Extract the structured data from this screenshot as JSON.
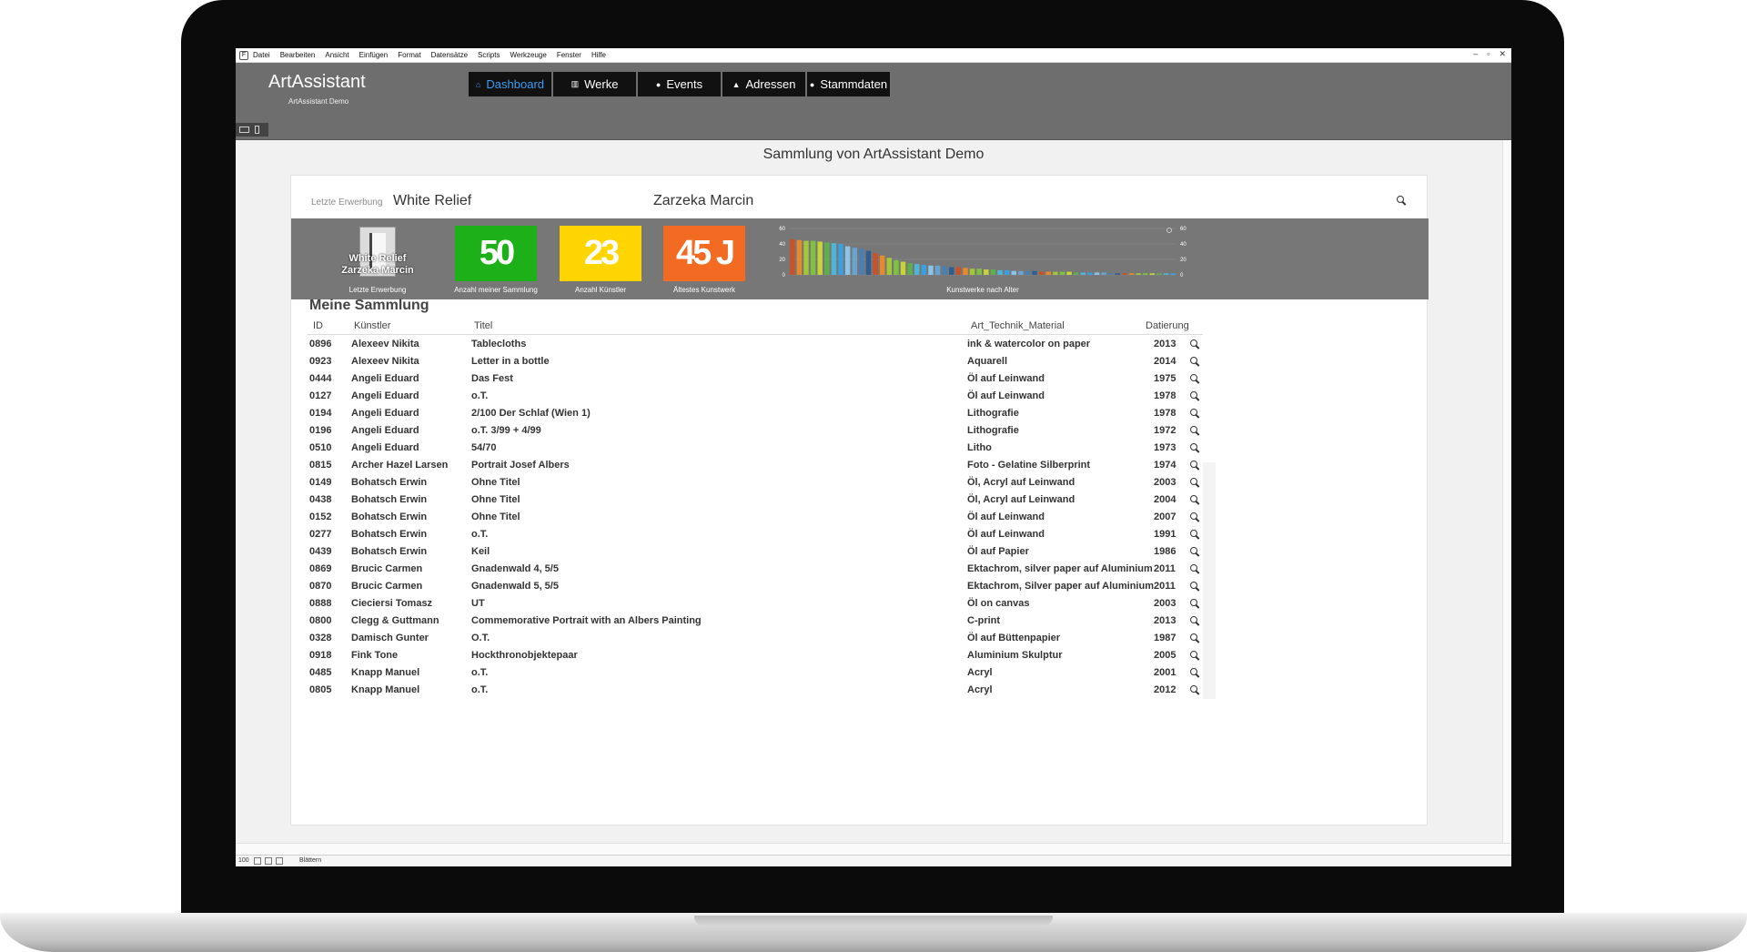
{
  "menu": [
    "Datei",
    "Bearbeiten",
    "Ansicht",
    "Einfügen",
    "Format",
    "Datensätze",
    "Scripts",
    "Werkzeuge",
    "Fenster",
    "Hilfe"
  ],
  "app": {
    "title": "ArtAssistant",
    "subtitle": "ArtAssistant Demo"
  },
  "nav": [
    {
      "label": "Dashboard",
      "icon": "home-icon",
      "active": true
    },
    {
      "label": "Werke",
      "icon": "grid-icon",
      "active": false
    },
    {
      "label": "Events",
      "icon": "globe-icon",
      "active": false
    },
    {
      "label": "Adressen",
      "icon": "person-icon",
      "active": false
    },
    {
      "label": "Stammdaten",
      "icon": "info-icon",
      "active": false
    }
  ],
  "collection_title": "Sammlung von ArtAssistant Demo",
  "latest": {
    "label": "Letzte Erwerbung",
    "title": "White Relief",
    "artist": "Zarzeka Marcin",
    "caption1": "White Relief",
    "caption2": "Zarzeka Marcin",
    "caption_label": "Letzte Erwerbung"
  },
  "kpis": [
    {
      "value": "50",
      "label": "Anzahl meiner Sammlung",
      "color": "#1eb018"
    },
    {
      "value": "23",
      "label": "Anzahl Künstler",
      "color": "#ffd500"
    },
    {
      "value": "45 J",
      "label": "Ältestes Kunstwerk",
      "color": "#f36a23"
    }
  ],
  "chart_data": {
    "type": "bar",
    "title": "",
    "xlabel": "Kunstwerke nach Alter",
    "ylabel": "",
    "ylim": [
      0,
      60
    ],
    "yticks": [
      "60",
      "40",
      "20",
      "0"
    ],
    "values": [
      46,
      45,
      44,
      44,
      43,
      42,
      41,
      40,
      37,
      35,
      34,
      31,
      28,
      25,
      22,
      19,
      17,
      15,
      14,
      13,
      12,
      12,
      11,
      10,
      10,
      9,
      8,
      8,
      7,
      7,
      6,
      6,
      5,
      5,
      5,
      5,
      4,
      4,
      4,
      4,
      4,
      3,
      3,
      3,
      3,
      3,
      2,
      2,
      2,
      2,
      2,
      2,
      2,
      2,
      2,
      2
    ],
    "colors": [
      "#c8532a",
      "#e88a2a",
      "#a4c639",
      "#7fc241",
      "#c6d43a",
      "#5fb04c",
      "#4fb5d6",
      "#3aa0e0",
      "#8bc4e8",
      "#69a3cf",
      "#4a7fb2",
      "#2f5f92"
    ]
  },
  "section_title": "Meine Sammlung",
  "columns": {
    "id": "ID",
    "artist": "Künstler",
    "title": "Titel",
    "material": "Art_Technik_Material",
    "date": "Datierung"
  },
  "rows": [
    {
      "id": "0896",
      "artist": "Alexeev Nikita",
      "title": "Tablecloths",
      "material": "ink & watercolor on paper",
      "date": "2013"
    },
    {
      "id": "0923",
      "artist": "Alexeev Nikita",
      "title": "Letter in a bottle",
      "material": "Aquarell",
      "date": "2014"
    },
    {
      "id": "0444",
      "artist": "Angeli Eduard",
      "title": "Das Fest",
      "material": "Öl auf Leinwand",
      "date": "1975"
    },
    {
      "id": "0127",
      "artist": "Angeli Eduard",
      "title": "o.T.",
      "material": "Öl auf Leinwand",
      "date": "1978"
    },
    {
      "id": "0194",
      "artist": "Angeli Eduard",
      "title": "2/100  Der Schlaf (Wien 1)",
      "material": "Lithografie",
      "date": "1978"
    },
    {
      "id": "0196",
      "artist": "Angeli Eduard",
      "title": "o.T.  3/99 + 4/99",
      "material": "Lithografie",
      "date": "1972"
    },
    {
      "id": "0510",
      "artist": "Angeli Eduard",
      "title": "54/70",
      "material": "Litho",
      "date": "1973"
    },
    {
      "id": "0815",
      "artist": "Archer Hazel Larsen",
      "title": "Portrait Josef Albers",
      "material": "Foto - Gelatine Silberprint",
      "date": "1974"
    },
    {
      "id": "0149",
      "artist": "Bohatsch Erwin",
      "title": "Ohne Titel",
      "material": "Öl, Acryl auf Leinwand",
      "date": "2003"
    },
    {
      "id": "0438",
      "artist": "Bohatsch Erwin",
      "title": "Ohne Titel",
      "material": "Öl, Acryl auf Leinwand",
      "date": "2004"
    },
    {
      "id": "0152",
      "artist": "Bohatsch Erwin",
      "title": "Ohne Titel",
      "material": "Öl auf Leinwand",
      "date": "2007"
    },
    {
      "id": "0277",
      "artist": "Bohatsch Erwin",
      "title": "o.T.",
      "material": "Öl auf Leinwand",
      "date": "1991"
    },
    {
      "id": "0439",
      "artist": "Bohatsch Erwin",
      "title": "Keil",
      "material": "Öl auf Papier",
      "date": "1986"
    },
    {
      "id": "0869",
      "artist": "Brucic Carmen",
      "title": "Gnadenwald 4, 5/5",
      "material": "Ektachrom, silver paper auf Aluminium",
      "date": "2011"
    },
    {
      "id": "0870",
      "artist": "Brucic Carmen",
      "title": "Gnadenwald 5, 5/5",
      "material": "Ektachrom, Silver paper auf Aluminium",
      "date": "2011"
    },
    {
      "id": "0888",
      "artist": "Cieciersi Tomasz",
      "title": "UT",
      "material": "Öl on canvas",
      "date": "2003"
    },
    {
      "id": "0800",
      "artist": "Clegg & Guttmann",
      "title": "Commemorative Portrait with an Albers Painting",
      "material": "C-print",
      "date": "2013"
    },
    {
      "id": "0328",
      "artist": "Damisch Gunter",
      "title": "O.T.",
      "material": "Öl auf Büttenpapier",
      "date": "1987"
    },
    {
      "id": "0918",
      "artist": "Fink Tone",
      "title": "Hockthronobjektepaar",
      "material": "Aluminium Skulptur",
      "date": "2005"
    },
    {
      "id": "0485",
      "artist": "Knapp Manuel",
      "title": "o.T.",
      "material": "Acryl",
      "date": "2001"
    },
    {
      "id": "0805",
      "artist": "Knapp Manuel",
      "title": "o.T.",
      "material": "Acryl",
      "date": "2012"
    }
  ],
  "status": {
    "zoom": "100",
    "mode": "Blättern"
  }
}
